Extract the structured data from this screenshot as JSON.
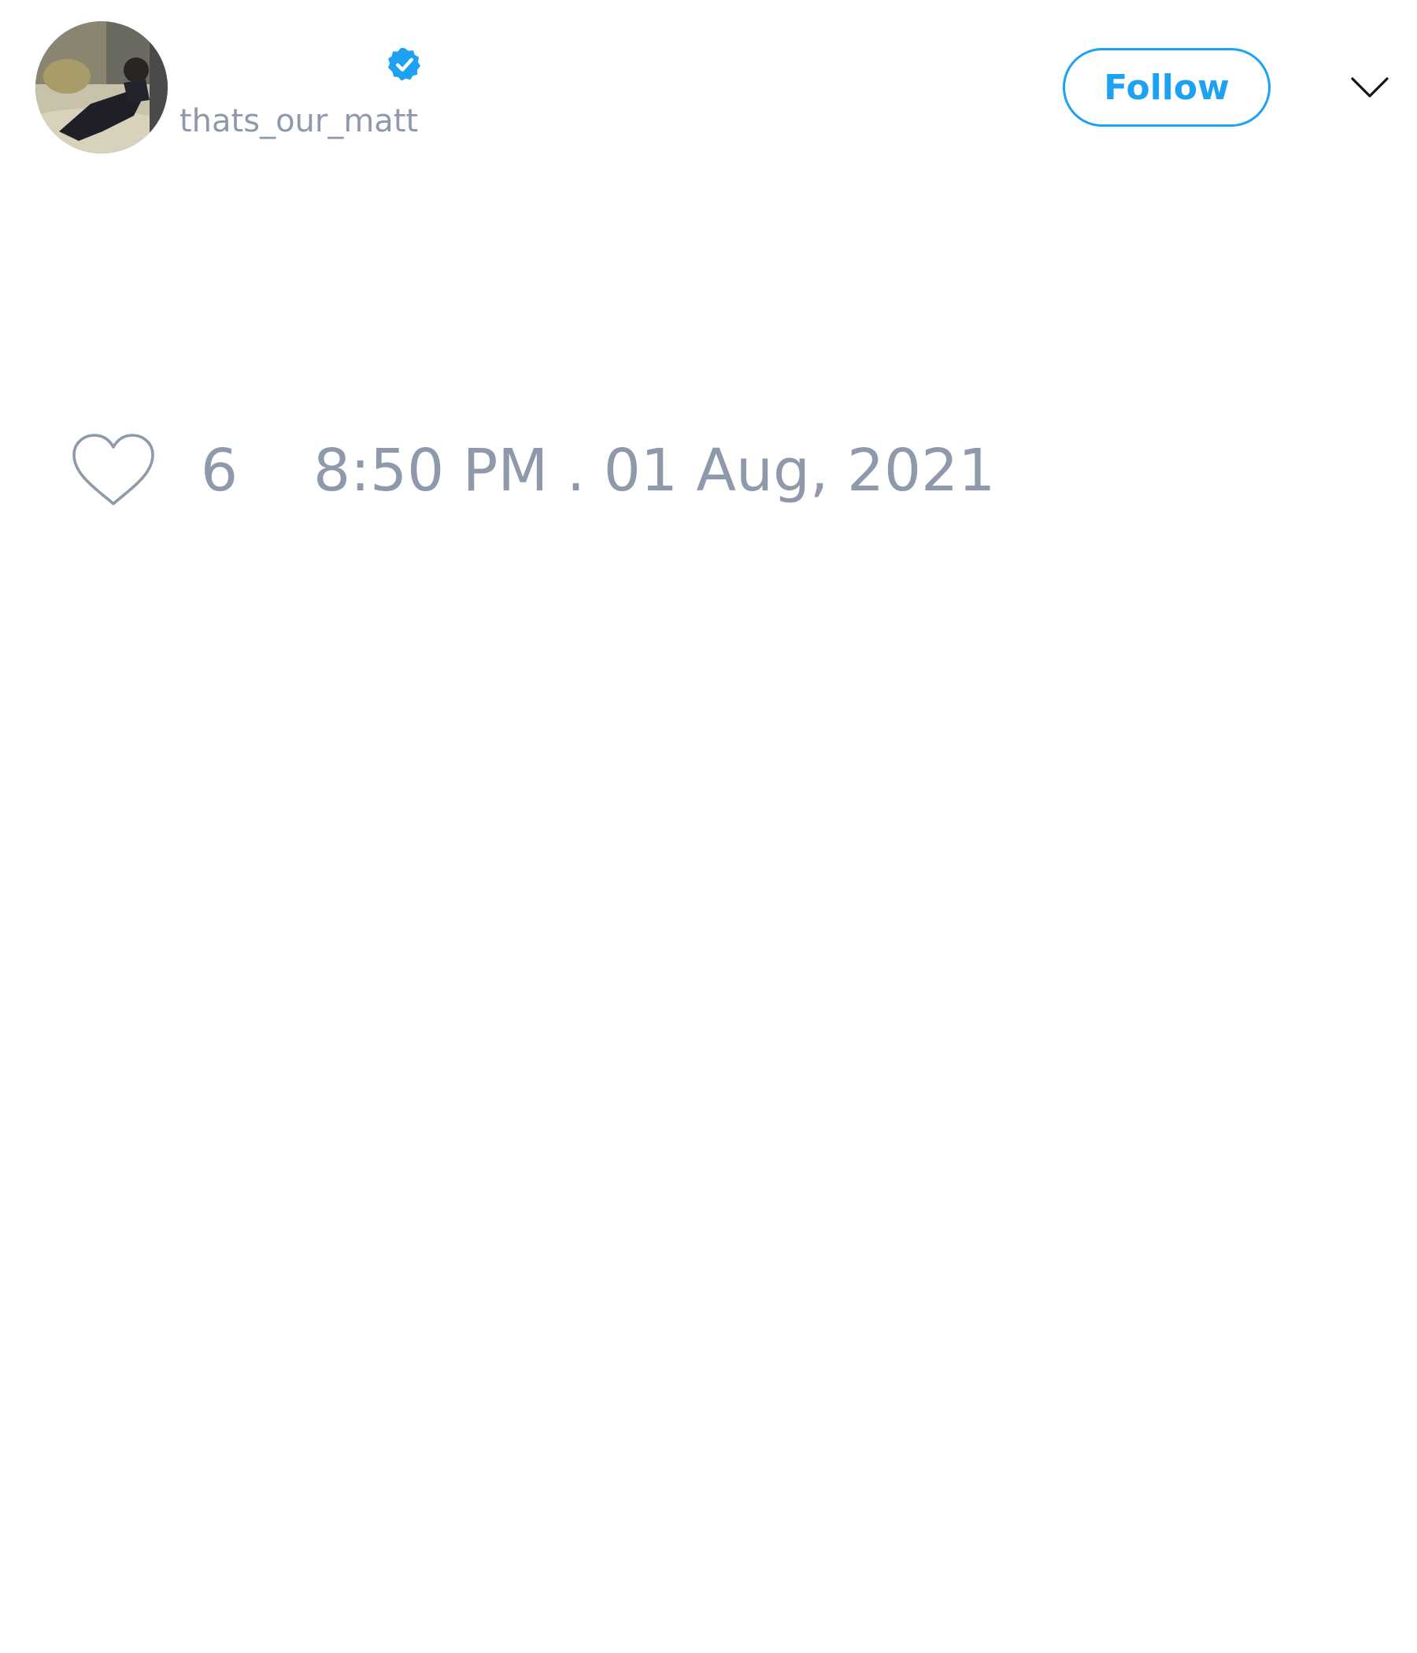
{
  "tweet": {
    "author": {
      "display_name": "",
      "handle": "thats_our_matt",
      "verified": true,
      "avatar": "profile-photo"
    },
    "follow_label": "Follow",
    "likes": "6",
    "timestamp": "8:50 PM . 01 Aug, 2021"
  },
  "icons": {
    "verified": "verified-badge-icon",
    "menu": "chevron-down-icon",
    "like": "heart-icon"
  },
  "colors": {
    "accent": "#1da1f2",
    "muted_text": "#8e9aab",
    "background": "#ffffff"
  }
}
